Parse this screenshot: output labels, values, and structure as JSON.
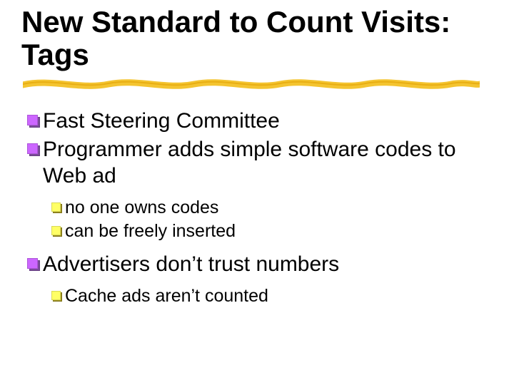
{
  "title": "New Standard to Count Visits: Tags",
  "bullets": {
    "b1": "Fast Steering Committee",
    "b2": "Programmer adds simple software codes to Web ad",
    "b2a": "no one owns codes",
    "b2b": "can be freely inserted",
    "b3": "Advertisers don’t trust numbers",
    "b3a": "Cache ads aren’t counted"
  }
}
